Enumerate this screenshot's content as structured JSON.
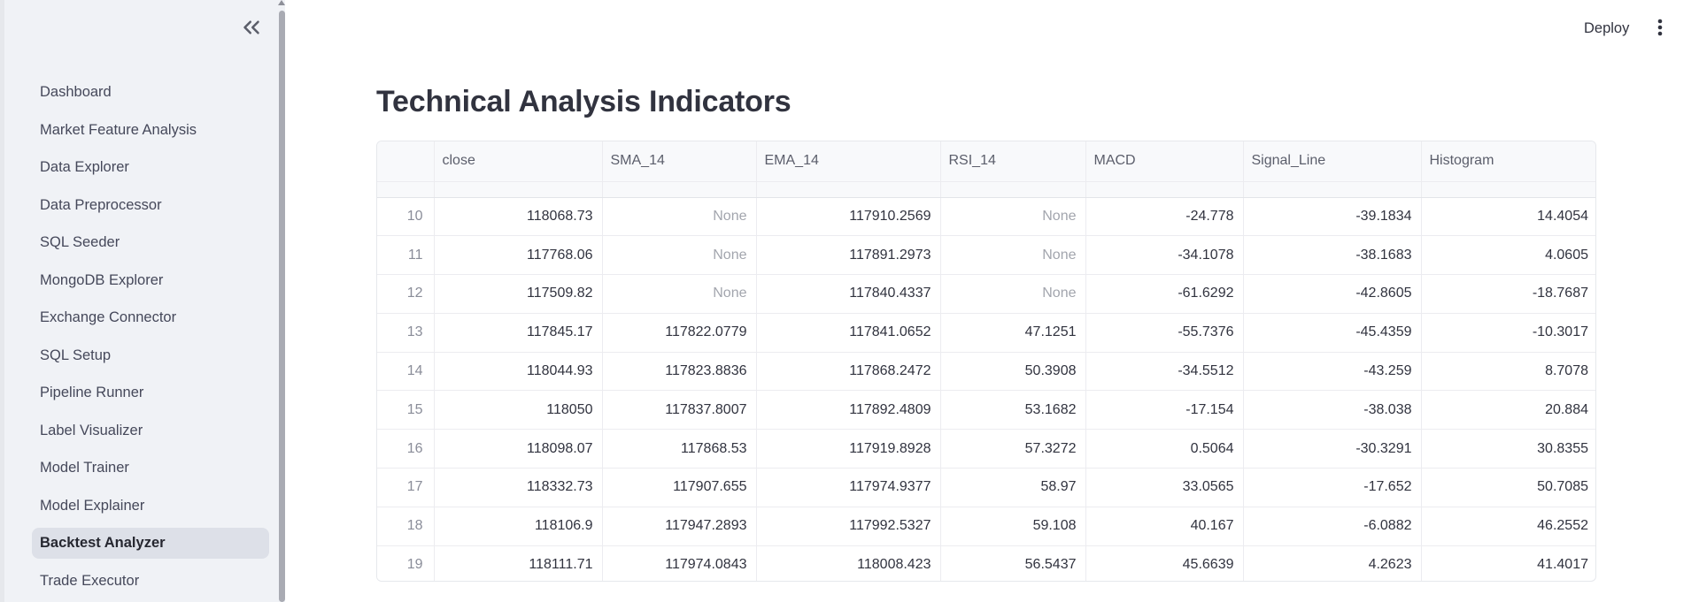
{
  "sidebar": {
    "items": [
      {
        "label": "Dashboard"
      },
      {
        "label": "Market Feature Analysis"
      },
      {
        "label": "Data Explorer"
      },
      {
        "label": "Data Preprocessor"
      },
      {
        "label": "SQL Seeder"
      },
      {
        "label": "MongoDB Explorer"
      },
      {
        "label": "Exchange Connector"
      },
      {
        "label": "SQL Setup"
      },
      {
        "label": "Pipeline Runner"
      },
      {
        "label": "Label Visualizer"
      },
      {
        "label": "Model Trainer"
      },
      {
        "label": "Model Explainer"
      },
      {
        "label": "Backtest Analyzer"
      },
      {
        "label": "Trade Executor"
      }
    ],
    "active_index": 12
  },
  "header": {
    "deploy_label": "Deploy"
  },
  "main": {
    "title": "Technical Analysis Indicators",
    "table": {
      "columns": [
        "",
        "close",
        "SMA_14",
        "EMA_14",
        "RSI_14",
        "MACD",
        "Signal_Line",
        "Histogram"
      ],
      "rows": [
        [
          "10",
          "118068.73",
          "None",
          "117910.2569",
          "None",
          "-24.778",
          "-39.1834",
          "14.4054"
        ],
        [
          "11",
          "117768.06",
          "None",
          "117891.2973",
          "None",
          "-34.1078",
          "-38.1683",
          "4.0605"
        ],
        [
          "12",
          "117509.82",
          "None",
          "117840.4337",
          "None",
          "-61.6292",
          "-42.8605",
          "-18.7687"
        ],
        [
          "13",
          "117845.17",
          "117822.0779",
          "117841.0652",
          "47.1251",
          "-55.7376",
          "-45.4359",
          "-10.3017"
        ],
        [
          "14",
          "118044.93",
          "117823.8836",
          "117868.2472",
          "50.3908",
          "-34.5512",
          "-43.259",
          "8.7078"
        ],
        [
          "15",
          "118050",
          "117837.8007",
          "117892.4809",
          "53.1682",
          "-17.154",
          "-38.038",
          "20.884"
        ],
        [
          "16",
          "118098.07",
          "117868.53",
          "117919.8928",
          "57.3272",
          "0.5064",
          "-30.3291",
          "30.8355"
        ],
        [
          "17",
          "118332.73",
          "117907.655",
          "117974.9377",
          "58.97",
          "33.0565",
          "-17.652",
          "50.7085"
        ],
        [
          "18",
          "118106.9",
          "117947.2893",
          "117992.5327",
          "59.108",
          "40.167",
          "-6.0882",
          "46.2552"
        ],
        [
          "19",
          "118111.71",
          "117974.0843",
          "118008.423",
          "56.5437",
          "45.6639",
          "4.2623",
          "41.4017"
        ]
      ]
    }
  },
  "colors": {
    "sidebar_bg": "#f0f2f6",
    "active_item_bg": "#dde0e8",
    "text": "#31333f",
    "none_text": "#a2a5ad"
  }
}
